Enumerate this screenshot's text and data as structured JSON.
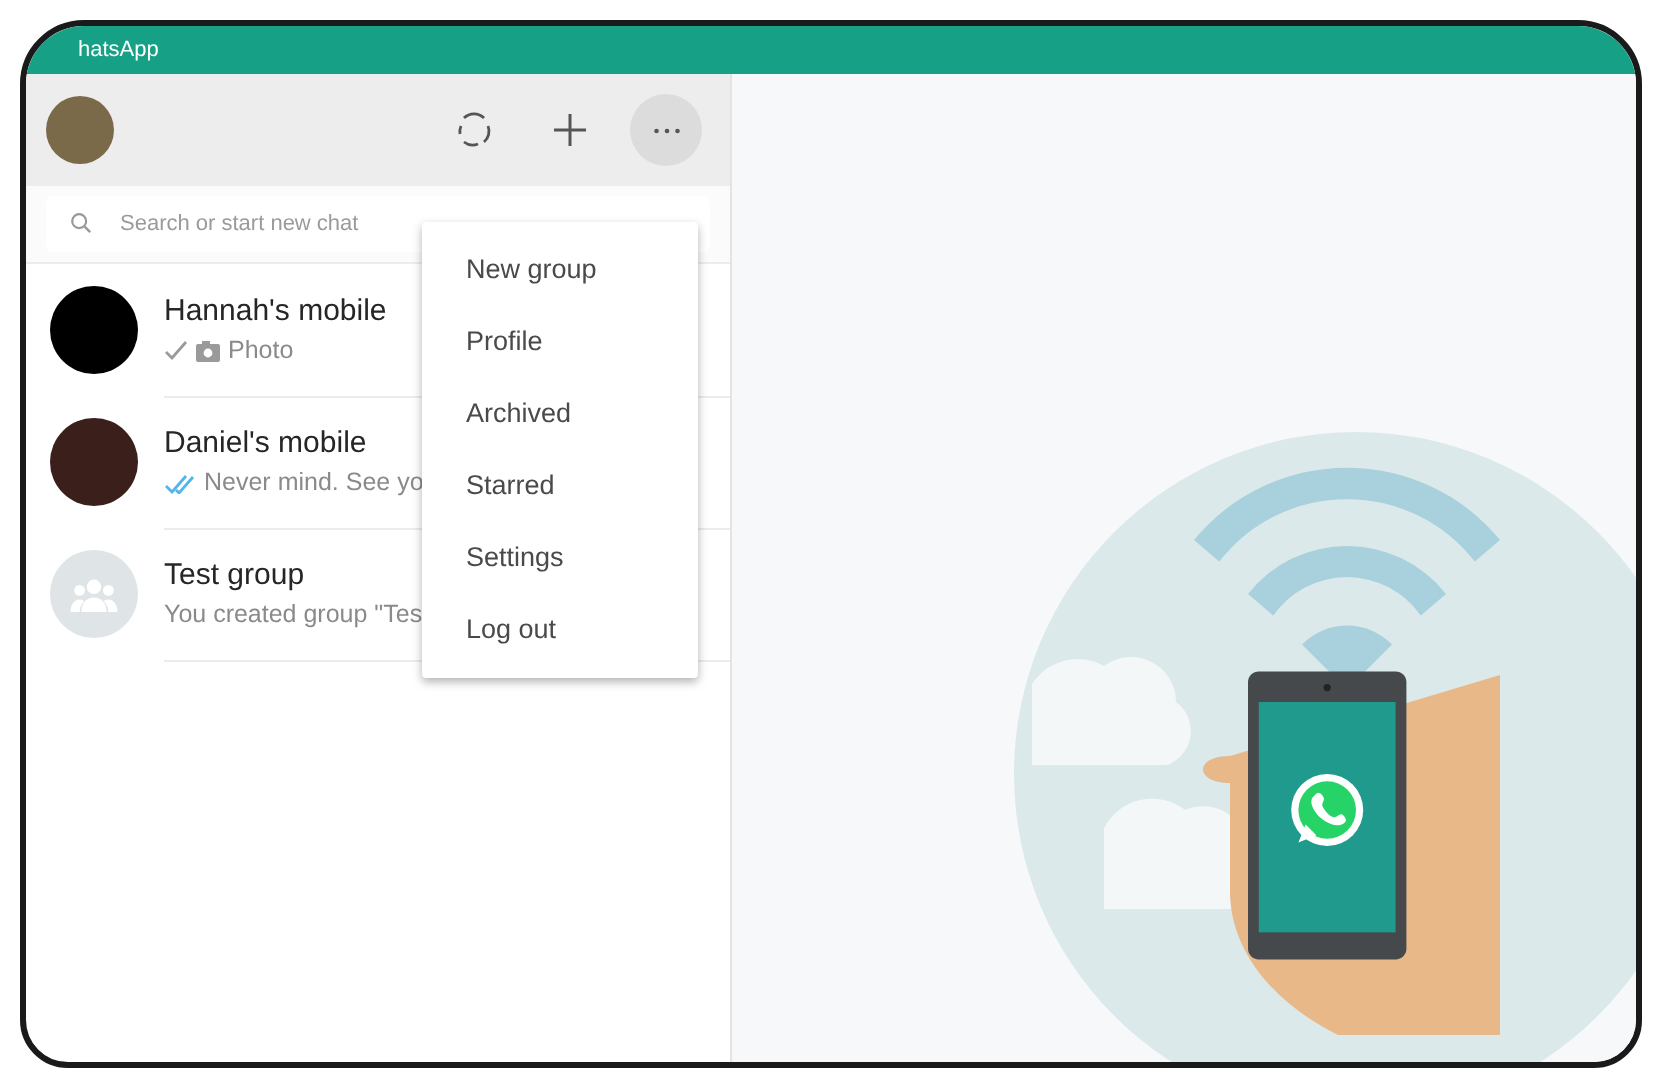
{
  "window": {
    "title": "hatsApp"
  },
  "header": {
    "avatar": {
      "kind": "photo"
    },
    "actions": [
      {
        "kind": "status"
      },
      {
        "kind": "new-chat"
      },
      {
        "kind": "menu",
        "selected": true
      }
    ]
  },
  "search": {
    "placeholder": "Search or start new chat"
  },
  "chats": [
    {
      "name": "Hannah's mobile",
      "avatar": {
        "kind": "photo"
      },
      "status": {
        "kind": "sent"
      },
      "media": {
        "kind": "photo"
      },
      "preview": "Photo"
    },
    {
      "name": "Daniel's mobile",
      "avatar": {
        "kind": "photo"
      },
      "status": {
        "kind": "read"
      },
      "preview": "Never mind. See yo"
    },
    {
      "name": "Test group",
      "avatar": {
        "kind": "group"
      },
      "preview": "You created group \"Tes"
    }
  ],
  "menu": {
    "items": [
      {
        "label": "New group"
      },
      {
        "label": "Profile"
      },
      {
        "label": "Archived"
      },
      {
        "label": "Starred"
      },
      {
        "label": "Settings"
      },
      {
        "label": "Log out"
      }
    ]
  }
}
